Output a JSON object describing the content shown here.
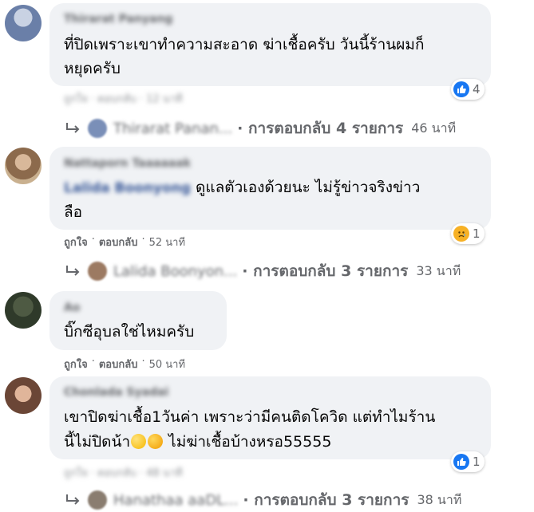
{
  "comments": [
    {
      "author": "Thirarat Panyang",
      "text_line1": "ที่ปิดเพราะเขาทำความสะอาด ฆ่าเชื้อครับ วันนี้ร้านผมก็",
      "text_line2": "หยุดครับ",
      "reaction_count": "4",
      "actions_blurred": "ถูกใจ · ตอบกลับ · 12 นาที",
      "reply_name": "Thirarat Panan...",
      "reply_label": "· การตอบกลับ 4 รายการ",
      "reply_time": "46 นาที"
    },
    {
      "author": "Nattaporn Taaaaaak",
      "tag": "Lalida Boonyong",
      "author_suffix": "ak",
      "text_line1": "ดูแลตัวเองด้วยนะ ไม่รู้ข่าวจริงข่าว",
      "text_line2": "ลือ",
      "reaction_count": "1",
      "action_like": "ถูกใจ",
      "action_reply": "ตอบกลับ",
      "time": "52 นาที",
      "reply_name": "Lalida Boonyon...",
      "reply_label": "· การตอบกลับ 3 รายการ",
      "reply_time": "33 นาที"
    },
    {
      "author": "Ao",
      "text_line1": "บิ๊กซีอุบลใช่ไหมครับ",
      "action_like": "ถูกใจ",
      "action_reply": "ตอบกลับ",
      "time": "50 นาที"
    },
    {
      "author": "Chonlada Syadai",
      "text_line1": "เขาปิดฆ่าเชื้อ1วันค่า เพราะว่ามีคนติดโควิด แต่ทำไมร้าน",
      "text_line2_a": "นี้ไม่ปิดน้า",
      "text_line2_b": " ไม่ฆ่าเชื้อบ้างหรอ55555",
      "reaction_count": "1",
      "actions_blurred": "ถูกใจ · ตอบกลับ · 48 นาที",
      "reply_name": "Hanathaa aaDL...",
      "reply_label": "· การตอบกลับ 3 รายการ",
      "reply_time": "38 นาที"
    }
  ],
  "colors": {
    "bubble": "#f0f2f5",
    "secondary_text": "#65676b",
    "like_blue": "#1877f2",
    "sad_yellow": "#f7b125"
  },
  "icons": [
    "like-icon",
    "sad-icon",
    "reply-arrow-icon",
    "rolling-eyes-emoji",
    "rofl-emoji"
  ]
}
